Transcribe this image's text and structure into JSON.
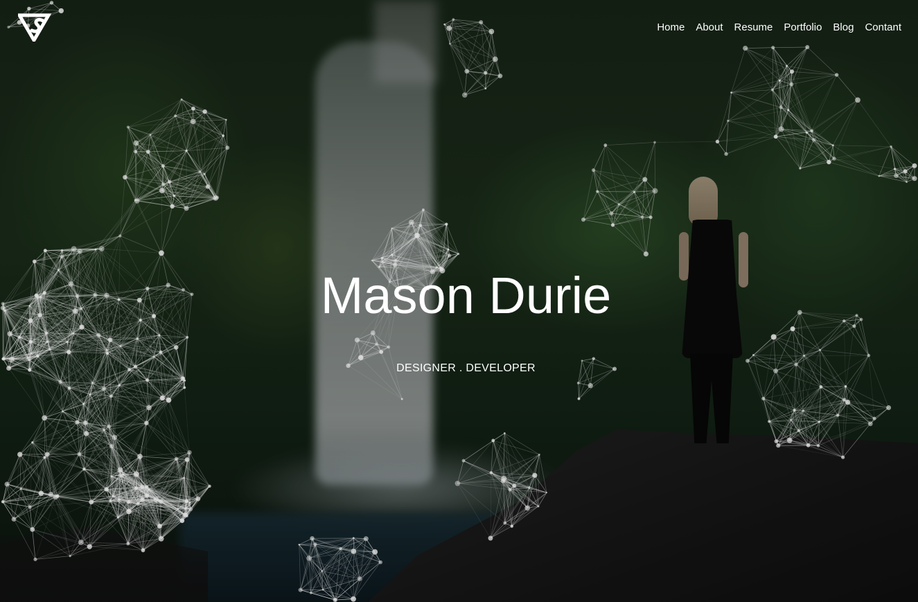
{
  "header": {
    "logo_icon": "vs-triangle-logo-icon",
    "nav": [
      {
        "label": "Home"
      },
      {
        "label": "About"
      },
      {
        "label": "Resume"
      },
      {
        "label": "Portfolio"
      },
      {
        "label": "Blog"
      },
      {
        "label": "Contant"
      }
    ]
  },
  "hero": {
    "name": "Mason Durie",
    "tagline": "DESIGNER . DEVELOPER",
    "background_icon": "waterfall-landscape-photo",
    "overlay_effect_icon": "particle-network-icon"
  },
  "colors": {
    "text": "#ffffff",
    "overlay": "#000000",
    "particle": "#dddddd"
  }
}
